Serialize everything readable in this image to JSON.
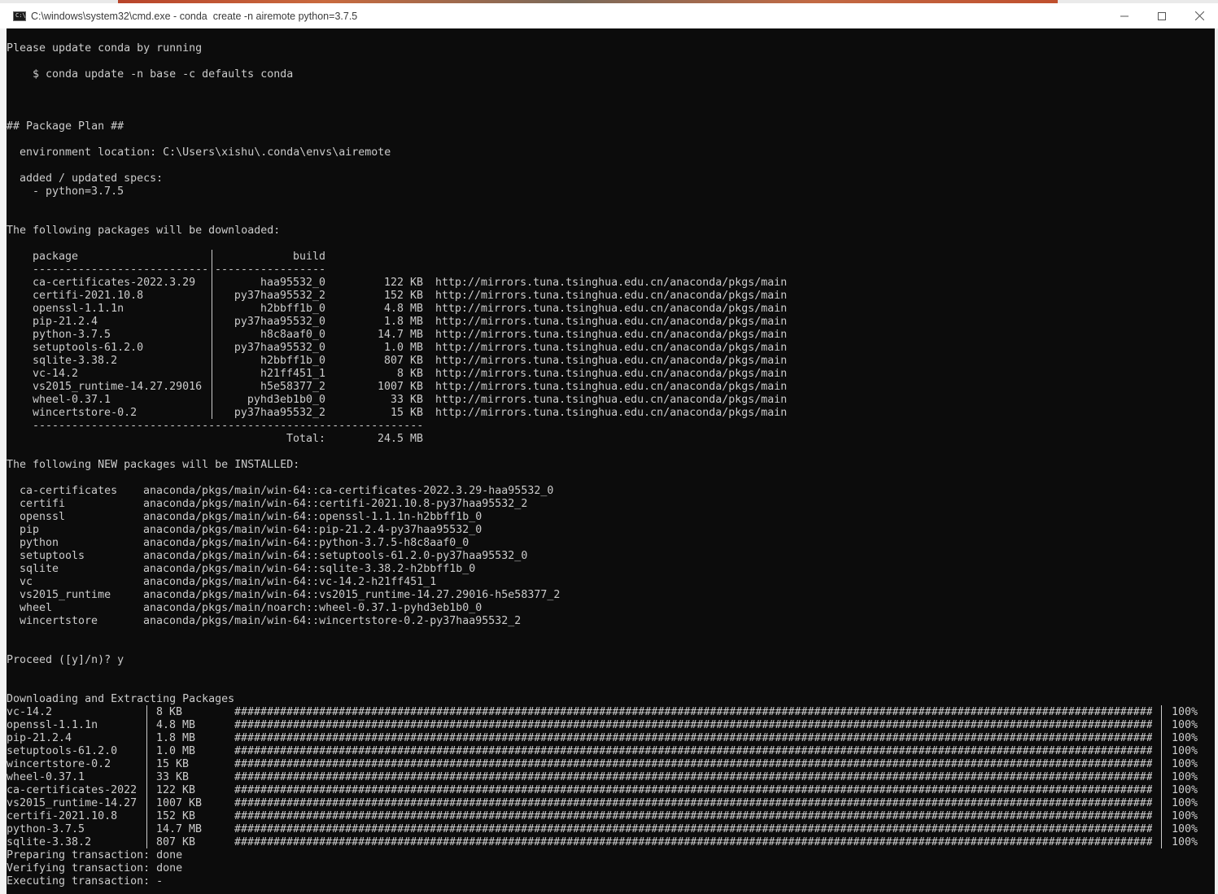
{
  "window": {
    "title": "C:\\windows\\system32\\cmd.exe - conda  create -n airemote python=3.7.5",
    "icon": "cmd-icon",
    "controls": [
      "minimize-icon",
      "maximize-icon",
      "close-icon"
    ]
  },
  "colors": {
    "console_bg": "#0c0c0c",
    "console_fg": "#cccccc",
    "titlebar_bg": "#ffffff"
  },
  "intro": {
    "update_msg": "Please update conda by running",
    "update_cmd": "$ conda update -n base -c defaults conda"
  },
  "package_plan": {
    "heading": "## Package Plan ##",
    "env_location": "environment location: C:\\Users\\xishu\\.conda\\envs\\airemote",
    "specs_heading": "added / updated specs:",
    "specs": [
      "- python=3.7.5"
    ]
  },
  "downloads": {
    "heading": "The following packages will be downloaded:",
    "col_package": "package",
    "col_build": "build",
    "rule_package": "---------------------------",
    "rule_build": "-----------------",
    "rule_bottom": "------------------------------------------------------------",
    "rows": [
      {
        "package": "ca-certificates-2022.3.29",
        "build": "haa95532_0",
        "size": "122 KB",
        "channel": "http://mirrors.tuna.tsinghua.edu.cn/anaconda/pkgs/main"
      },
      {
        "package": "certifi-2021.10.8",
        "build": "py37haa95532_2",
        "size": "152 KB",
        "channel": "http://mirrors.tuna.tsinghua.edu.cn/anaconda/pkgs/main"
      },
      {
        "package": "openssl-1.1.1n",
        "build": "h2bbff1b_0",
        "size": "4.8 MB",
        "channel": "http://mirrors.tuna.tsinghua.edu.cn/anaconda/pkgs/main"
      },
      {
        "package": "pip-21.2.4",
        "build": "py37haa95532_0",
        "size": "1.8 MB",
        "channel": "http://mirrors.tuna.tsinghua.edu.cn/anaconda/pkgs/main"
      },
      {
        "package": "python-3.7.5",
        "build": "h8c8aaf0_0",
        "size": "14.7 MB",
        "channel": "http://mirrors.tuna.tsinghua.edu.cn/anaconda/pkgs/main"
      },
      {
        "package": "setuptools-61.2.0",
        "build": "py37haa95532_0",
        "size": "1.0 MB",
        "channel": "http://mirrors.tuna.tsinghua.edu.cn/anaconda/pkgs/main"
      },
      {
        "package": "sqlite-3.38.2",
        "build": "h2bbff1b_0",
        "size": "807 KB",
        "channel": "http://mirrors.tuna.tsinghua.edu.cn/anaconda/pkgs/main"
      },
      {
        "package": "vc-14.2",
        "build": "h21ff451_1",
        "size": "8 KB",
        "channel": "http://mirrors.tuna.tsinghua.edu.cn/anaconda/pkgs/main"
      },
      {
        "package": "vs2015_runtime-14.27.29016",
        "build": "h5e58377_2",
        "size": "1007 KB",
        "channel": "http://mirrors.tuna.tsinghua.edu.cn/anaconda/pkgs/main"
      },
      {
        "package": "wheel-0.37.1",
        "build": "pyhd3eb1b0_0",
        "size": "33 KB",
        "channel": "http://mirrors.tuna.tsinghua.edu.cn/anaconda/pkgs/main"
      },
      {
        "package": "wincertstore-0.2",
        "build": "py37haa95532_2",
        "size": "15 KB",
        "channel": "http://mirrors.tuna.tsinghua.edu.cn/anaconda/pkgs/main"
      }
    ],
    "total_label": "Total:",
    "total_value": "24.5 MB"
  },
  "installs": {
    "heading": "The following NEW packages will be INSTALLED:",
    "rows": [
      {
        "name": "ca-certificates",
        "spec": "anaconda/pkgs/main/win-64::ca-certificates-2022.3.29-haa95532_0"
      },
      {
        "name": "certifi",
        "spec": "anaconda/pkgs/main/win-64::certifi-2021.10.8-py37haa95532_2"
      },
      {
        "name": "openssl",
        "spec": "anaconda/pkgs/main/win-64::openssl-1.1.1n-h2bbff1b_0"
      },
      {
        "name": "pip",
        "spec": "anaconda/pkgs/main/win-64::pip-21.2.4-py37haa95532_0"
      },
      {
        "name": "python",
        "spec": "anaconda/pkgs/main/win-64::python-3.7.5-h8c8aaf0_0"
      },
      {
        "name": "setuptools",
        "spec": "anaconda/pkgs/main/win-64::setuptools-61.2.0-py37haa95532_0"
      },
      {
        "name": "sqlite",
        "spec": "anaconda/pkgs/main/win-64::sqlite-3.38.2-h2bbff1b_0"
      },
      {
        "name": "vc",
        "spec": "anaconda/pkgs/main/win-64::vc-14.2-h21ff451_1"
      },
      {
        "name": "vs2015_runtime",
        "spec": "anaconda/pkgs/main/win-64::vs2015_runtime-14.27.29016-h5e58377_2"
      },
      {
        "name": "wheel",
        "spec": "anaconda/pkgs/main/noarch::wheel-0.37.1-pyhd3eb1b0_0"
      },
      {
        "name": "wincertstore",
        "spec": "anaconda/pkgs/main/win-64::wincertstore-0.2-py37haa95532_2"
      }
    ]
  },
  "proceed": "Proceed ([y]/n)? y",
  "progress": {
    "heading": "Downloading and Extracting Packages",
    "bar": "#######################################################################################################################################################",
    "rows": [
      {
        "name": "vc-14.2",
        "size": "8 KB",
        "pct": "100%"
      },
      {
        "name": "openssl-1.1.1n",
        "size": "4.8 MB",
        "pct": "100%"
      },
      {
        "name": "pip-21.2.4",
        "size": "1.8 MB",
        "pct": "100%"
      },
      {
        "name": "setuptools-61.2.0",
        "size": "1.0 MB",
        "pct": "100%"
      },
      {
        "name": "wincertstore-0.2",
        "size": "15 KB",
        "pct": "100%"
      },
      {
        "name": "wheel-0.37.1",
        "size": "33 KB",
        "pct": "100%"
      },
      {
        "name": "ca-certificates-2022",
        "size": "122 KB",
        "pct": "100%"
      },
      {
        "name": "vs2015_runtime-14.27",
        "size": "1007 KB",
        "pct": "100%"
      },
      {
        "name": "certifi-2021.10.8",
        "size": "152 KB",
        "pct": "100%"
      },
      {
        "name": "python-3.7.5",
        "size": "14.7 MB",
        "pct": "100%"
      },
      {
        "name": "sqlite-3.38.2",
        "size": "807 KB",
        "pct": "100%"
      }
    ]
  },
  "transactions": [
    "Preparing transaction: done",
    "Verifying transaction: done",
    "Executing transaction: -"
  ]
}
